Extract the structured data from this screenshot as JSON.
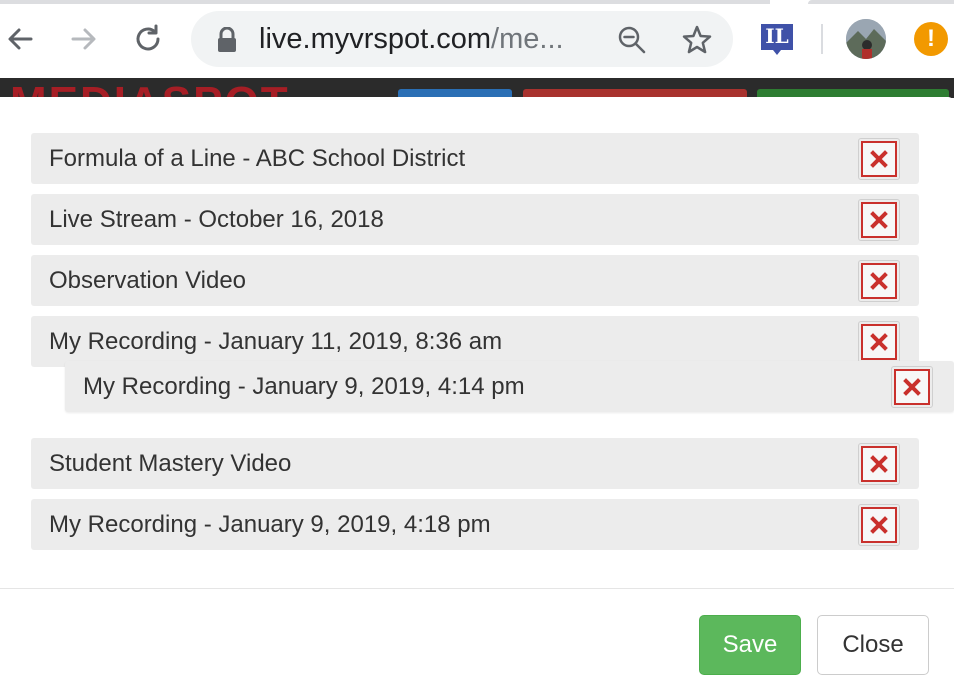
{
  "browser": {
    "url_host": "live.myvrspot.com",
    "url_path": "/me...",
    "extension_label": "IL",
    "update_glyph": "!"
  },
  "site": {
    "logo_text": "MEDIASPOT"
  },
  "modal": {
    "items": [
      {
        "label": "Formula of a Line - ABC School District"
      },
      {
        "label": "Live Stream - October 16, 2018"
      },
      {
        "label": "Observation Video"
      },
      {
        "label": "My Recording - January 11, 2019, 8:36 am"
      },
      {
        "label": "My Recording - January 9, 2019, 4:14 pm"
      },
      {
        "label": "Student Mastery Video"
      },
      {
        "label": "My Recording - January 9, 2019, 4:18 pm"
      }
    ],
    "delete_icon": "times-icon",
    "save_label": "Save",
    "close_label": "Close"
  },
  "colors": {
    "save": "#5cb85c",
    "delete_border": "#c9302c",
    "item_bg": "#ececec",
    "logo": "#a61e25"
  }
}
